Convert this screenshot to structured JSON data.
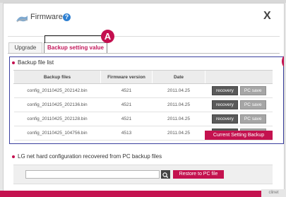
{
  "dialog": {
    "title": "Firmware",
    "help_label": "?",
    "close_label": "X"
  },
  "tabs": [
    {
      "label": "Upgrade"
    },
    {
      "label": "Backup setting value"
    }
  ],
  "callouts": {
    "a": "A"
  },
  "backup_list": {
    "title": "Backup file list",
    "columns": [
      "Backup files",
      "Firmware version",
      "Date",
      ""
    ],
    "rows": [
      {
        "file": "config_20110425_202142.bin",
        "version": "4521",
        "date": "2011.04.25"
      },
      {
        "file": "config_20110425_202136.bin",
        "version": "4521",
        "date": "2011.04.25"
      },
      {
        "file": "config_20110425_202128.bin",
        "version": "4521",
        "date": "2011.04.25"
      },
      {
        "file": "config_20110425_104756.bin",
        "version": "4513",
        "date": "2011.04.25"
      }
    ],
    "recovery_label": "recovery",
    "pcsave_label": "PC save",
    "current_backup_label": "Current Setting Backup"
  },
  "restore": {
    "title": "LG net hard configuration recovered from PC backup files",
    "input_value": "",
    "restore_label": "Restore to PC file"
  },
  "footer": {
    "tag": "clinet"
  },
  "colors": {
    "accent": "#c4124f",
    "outline": "#3a3f9e"
  }
}
